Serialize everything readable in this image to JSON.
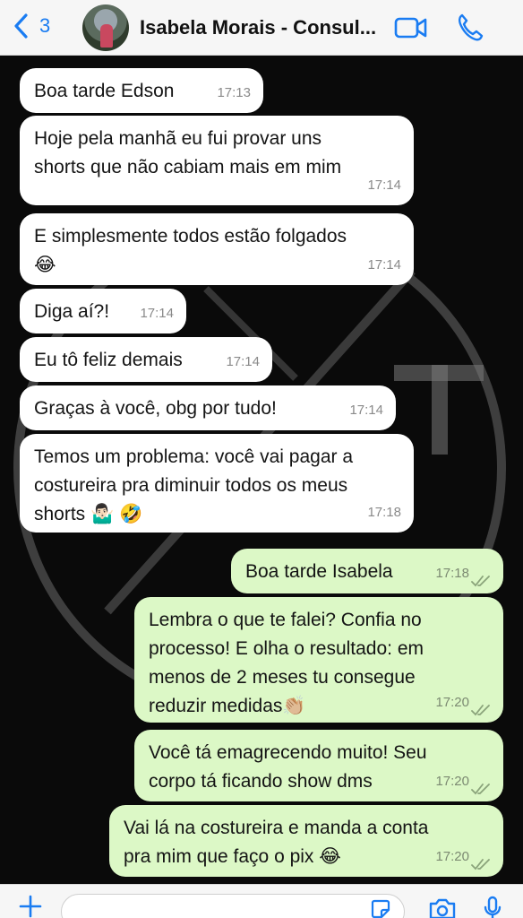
{
  "header": {
    "back_count": "3",
    "contact_name": "Isabela Morais - Consul..."
  },
  "messages": [
    {
      "direction": "in",
      "text": "Boa tarde Edson",
      "time": "17:13"
    },
    {
      "direction": "in",
      "text": "Hoje pela manhã eu fui provar uns\nshorts que não cabiam mais em mim",
      "time": "17:14"
    },
    {
      "direction": "in",
      "text": "E simplesmente todos estão folgados\n😂",
      "time": "17:14"
    },
    {
      "direction": "in",
      "text": "Diga aí?!",
      "time": "17:14"
    },
    {
      "direction": "in",
      "text": "Eu tô feliz demais",
      "time": "17:14"
    },
    {
      "direction": "in",
      "text": "Graças à você, obg por tudo!",
      "time": "17:14"
    },
    {
      "direction": "in",
      "text": "Temos um problema: você vai pagar a\ncostureira pra diminuir todos os meus\nshorts 🤷🏻‍♂️ 🤣",
      "time": "17:18"
    },
    {
      "direction": "out",
      "text": "Boa tarde Isabela",
      "time": "17:18",
      "status": "read"
    },
    {
      "direction": "out",
      "text": "Lembra o que te falei? Confia no\nprocesso! E olha o resultado: em\nmenos de 2 meses tu consegue\nreduzir medidas👏🏼",
      "time": "17:20",
      "status": "read"
    },
    {
      "direction": "out",
      "text": "Você tá emagrecendo muito! Seu\ncorpo tá ficando show dms",
      "time": "17:20",
      "status": "read"
    },
    {
      "direction": "out",
      "text": "Vai lá na costureira e manda a conta\npra mim que faço o pix 😂",
      "time": "17:20",
      "status": "read"
    }
  ],
  "input": {
    "placeholder": "",
    "value": ""
  },
  "icons": {
    "back": "chevron-left-icon",
    "video": "video-camera-icon",
    "phone": "phone-icon",
    "plus": "plus-icon",
    "sticker": "sticker-icon",
    "camera": "camera-icon",
    "mic": "microphone-icon"
  },
  "colors": {
    "accent": "#1a7cf2",
    "incoming_bubble": "#ffffff",
    "outgoing_bubble": "#dcf8c6",
    "chat_background": "#0a0a0a"
  }
}
